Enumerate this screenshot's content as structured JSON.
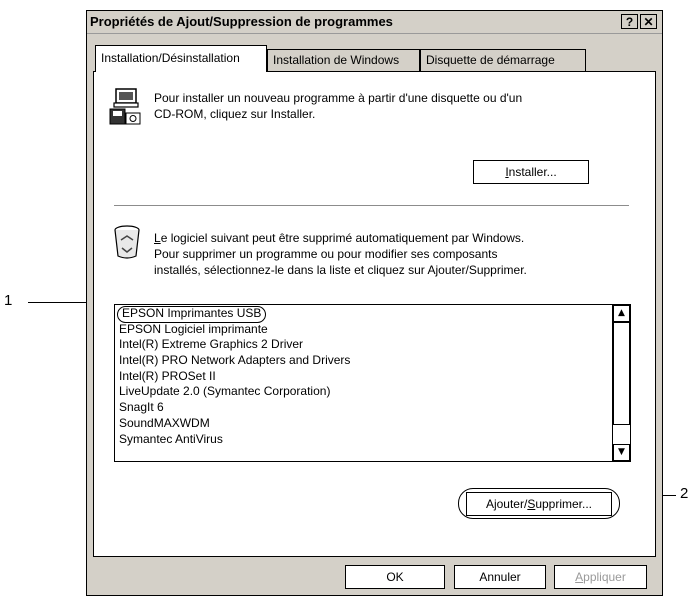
{
  "window": {
    "title": "Propriétés de Ajout/Suppression de programmes",
    "help_label": "?",
    "close_label": "✕"
  },
  "tabs": [
    {
      "label": "Installation/Désinstallation",
      "active": true
    },
    {
      "label": "Installation de Windows",
      "active": false
    },
    {
      "label": "Disquette de démarrage",
      "active": false
    }
  ],
  "install_section": {
    "icon": "install-icon",
    "line1": "Pour installer un nouveau programme à partir d'une disquette ou d'un",
    "line2": "CD-ROM, cliquez sur Installer.",
    "button_mnemonic": "I",
    "button_rest": "nstaller..."
  },
  "remove_section": {
    "icon": "recycle-bin-icon",
    "line1_mnemonic": "L",
    "line1_rest": "e logiciel suivant peut être supprimé automatiquement par Windows.",
    "line2": "Pour supprimer un programme ou pour modifier ses composants",
    "line3": "installés, sélectionnez-le dans la liste et cliquez sur Ajouter/Supprimer."
  },
  "program_list": [
    "EPSON Imprimantes USB",
    "EPSON Logiciel imprimante",
    "Intel(R) Extreme Graphics 2 Driver",
    "Intel(R) PRO Network Adapters and Drivers",
    "Intel(R) PROSet II",
    "LiveUpdate 2.0 (Symantec Corporation)",
    "SnagIt 6",
    "SoundMAXWDM",
    "Symantec AntiVirus"
  ],
  "scrollbar": {
    "up": "▲",
    "down": "▼"
  },
  "add_remove_button": {
    "prefix": "Ajouter/",
    "mnemonic": "S",
    "rest": "upprimer..."
  },
  "footer": {
    "ok": "OK",
    "cancel": "Annuler",
    "apply_mnemonic": "A",
    "apply_rest": "ppliquer"
  },
  "callouts": {
    "one": "1",
    "two": "2"
  }
}
